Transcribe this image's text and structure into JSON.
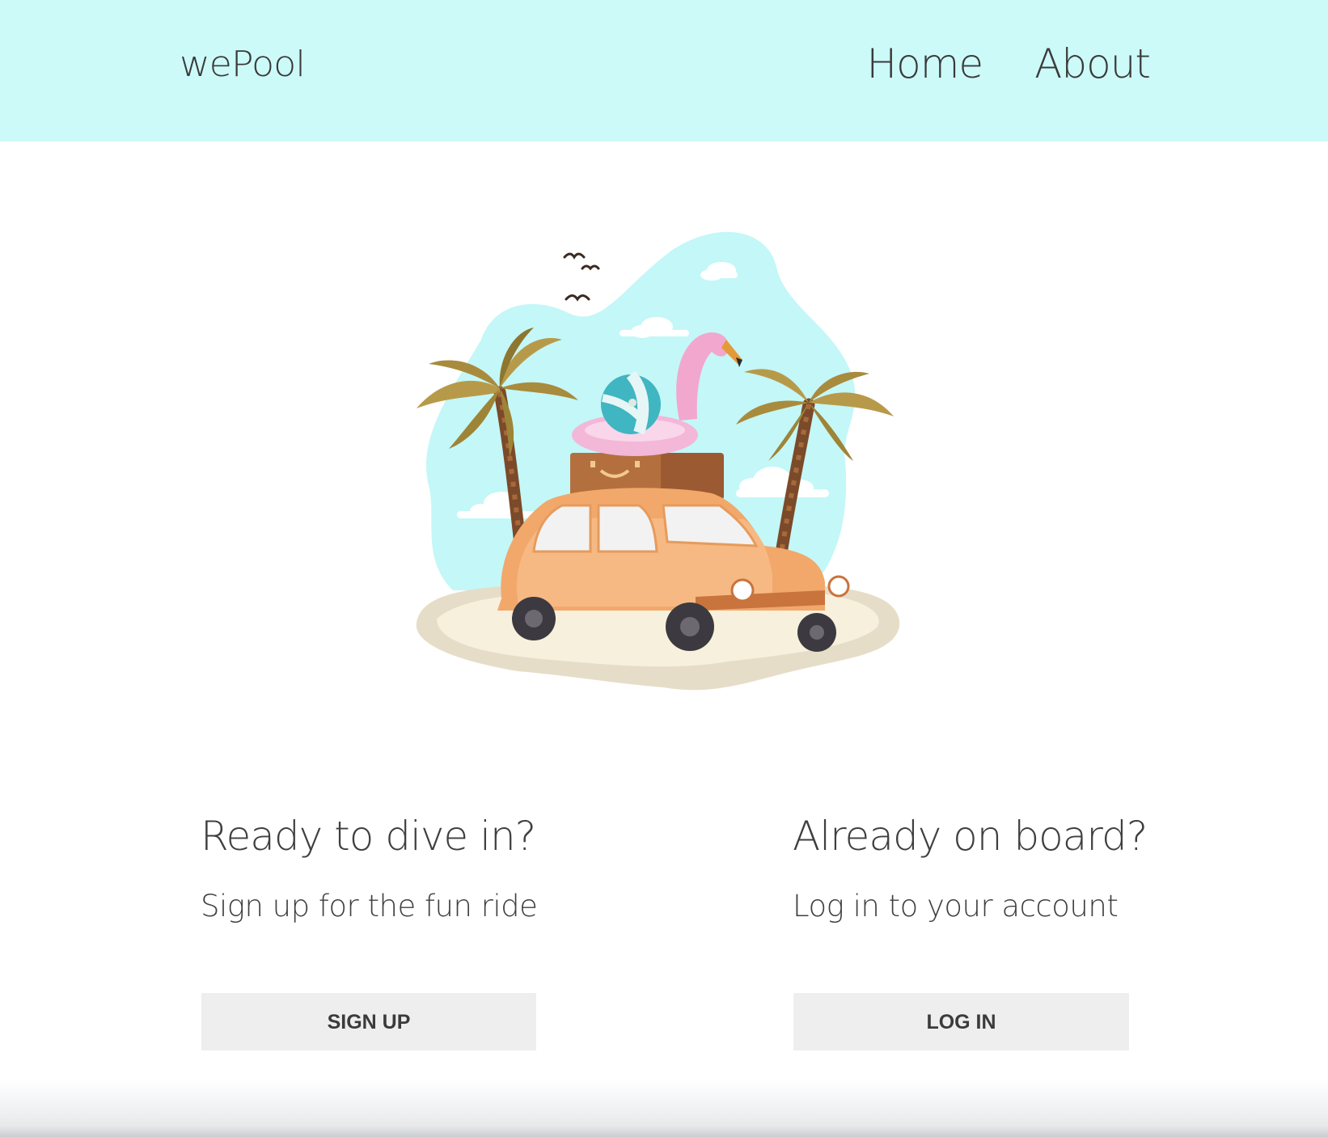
{
  "navbar": {
    "brand": "wePool",
    "links": [
      "Home",
      "About"
    ]
  },
  "hero": {
    "image": "beach-car-illustration"
  },
  "signup": {
    "heading": "Ready to dive in?",
    "subtext": "Sign up for the fun ride",
    "button": "SIGN UP"
  },
  "login": {
    "heading": "Already on board?",
    "subtext": "Log in to your account",
    "button": "LOG IN"
  },
  "colors": {
    "navbar_bg": "#ccfaf8",
    "button_bg": "#eeeeee",
    "text": "#3f3f3f"
  }
}
